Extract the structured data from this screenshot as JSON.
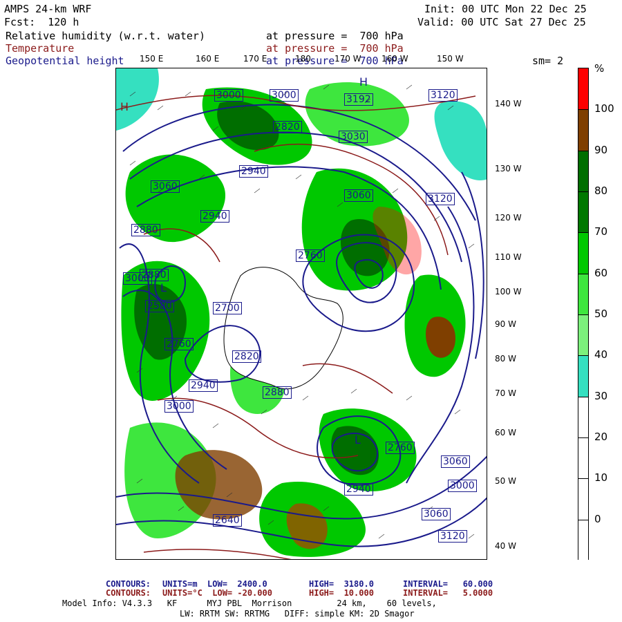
{
  "header": {
    "model": "AMPS 24-km WRF",
    "init": "Init: 00 UTC Mon 22 Dec 25",
    "fcst": "Fcst:  120 h",
    "valid": "Valid: 00 UTC Sat 27 Dec 25",
    "fields": [
      {
        "name": "Relative humidity (w.r.t. water)",
        "level": "at pressure =  700 hPa",
        "color": "#000000"
      },
      {
        "name": "Temperature",
        "level": "at pressure =  700 hPa",
        "color": "#8b1a1a"
      },
      {
        "name": "Geopotential height",
        "level": "at pressure =  700 hPa",
        "color": "#1a1a8b"
      }
    ],
    "smoothing": "sm= 2"
  },
  "longitudes_top": [
    "150 E",
    "160 E",
    "170 E",
    "180",
    "170 W",
    "160 W",
    "150 W"
  ],
  "latitudes_right": [
    "140 W",
    "130 W",
    "120 W",
    "110 W",
    "100 W",
    "90 W",
    "80 W",
    "70 W",
    "60 W",
    "50 W",
    "40 W"
  ],
  "colorbar": {
    "unit": "%",
    "labels": [
      "100",
      "90",
      "80",
      "70",
      "60",
      "50",
      "40",
      "30",
      "20",
      "10",
      "0"
    ],
    "colors": [
      "#ff0000",
      "#7f3f00",
      "#006e00",
      "#007800",
      "#00c800",
      "#3ee63e",
      "#7cf07c",
      "#35e0c0",
      "#ffffff",
      "#ffffff",
      "#ffffff",
      "#ffffff"
    ]
  },
  "map_labels": {
    "highs": [
      {
        "text": "H"
      },
      {
        "text": "H"
      }
    ],
    "lows": [
      {
        "text": "L"
      },
      {
        "text": "L"
      }
    ],
    "height_labels": [
      "3000",
      "3000",
      "3192",
      "3120",
      "2820",
      "3030",
      "2940",
      "3060",
      "2940",
      "2880",
      "3000",
      "2880",
      "3060",
      "3120",
      "2760",
      "2580",
      "2700",
      "2760",
      "2820",
      "2940",
      "3000",
      "2880",
      "2760",
      "3060",
      "2640",
      "2940",
      "3000",
      "3060",
      "3120"
    ]
  },
  "footer": {
    "contours1_label": "CONTOURS:",
    "contours1": "UNITS=m  LOW=  2400.0",
    "contours1_high": "HIGH=  3180.0",
    "contours1_int": "INTERVAL=   60.000",
    "contours2_label": "CONTOURS:",
    "contours2": "UNITS=°C  LOW= -20.000",
    "contours2_high": "HIGH=  10.000",
    "contours2_int": "INTERVAL=   5.0000",
    "model_info": "Model Info: V4.3.3   KF      MYJ PBL  Morrison         24 km,    60 levels,",
    "model_info2": "LW: RRTM SW: RRTMG   DIFF: simple KM: 2D Smagor"
  }
}
